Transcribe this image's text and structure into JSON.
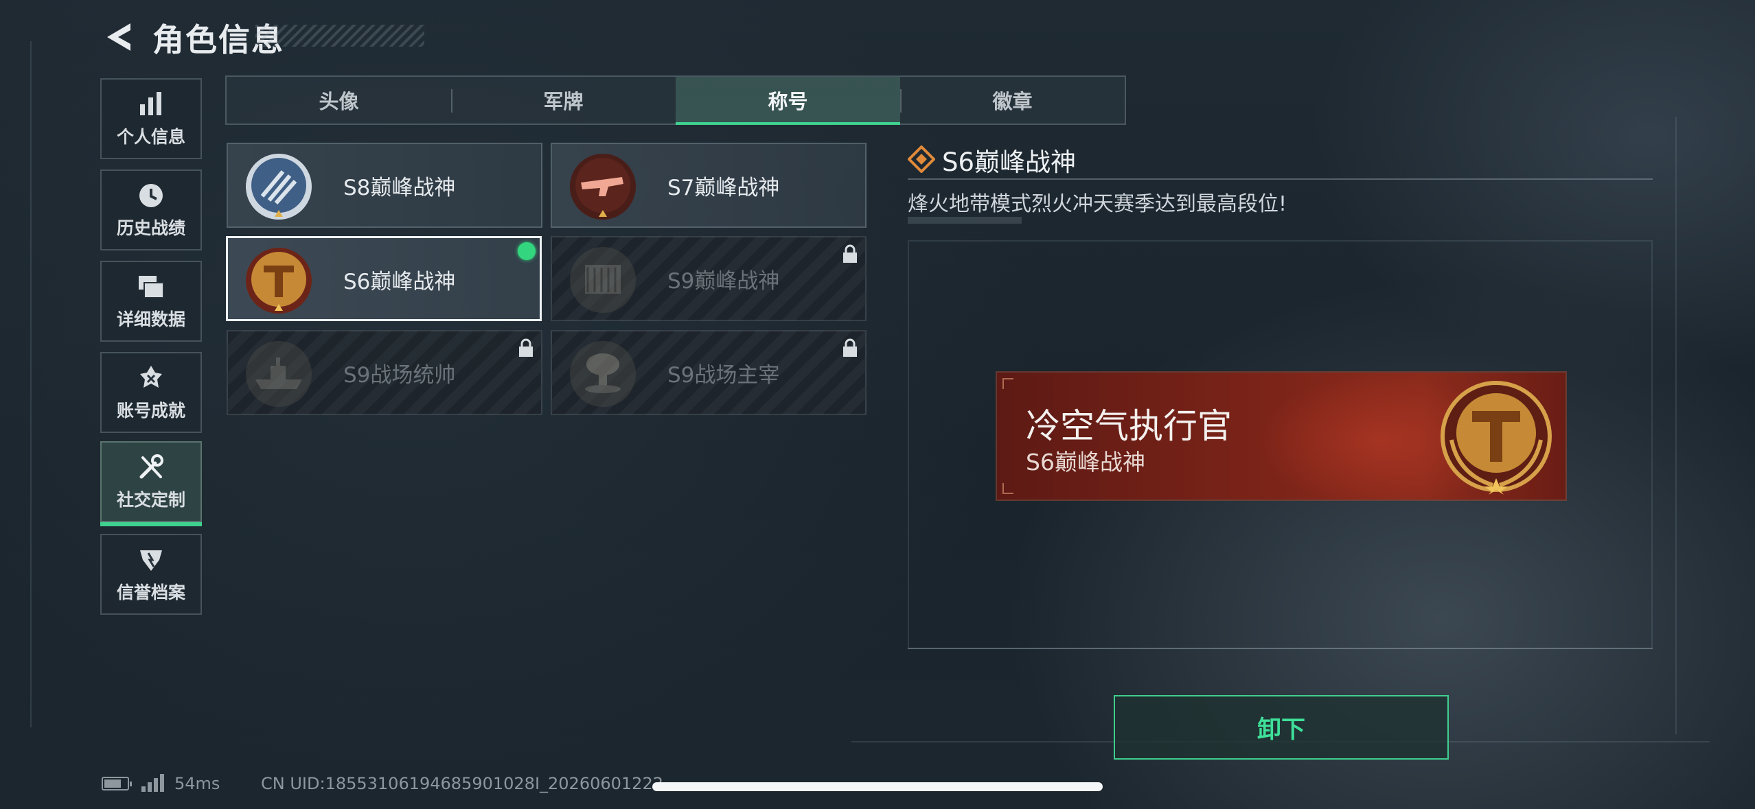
{
  "header": {
    "title": "角色信息"
  },
  "sidebar": {
    "items": [
      {
        "label": "个人信息",
        "icon": "bar-chart-icon",
        "active": false
      },
      {
        "label": "历史战绩",
        "icon": "clock-icon",
        "active": false
      },
      {
        "label": "详细数据",
        "icon": "folders-icon",
        "active": false
      },
      {
        "label": "账号成就",
        "icon": "achievement-icon",
        "active": false
      },
      {
        "label": "社交定制",
        "icon": "tools-icon",
        "active": true
      },
      {
        "label": "信誉档案",
        "icon": "shield-icon",
        "active": false
      }
    ]
  },
  "tabs": [
    {
      "label": "头像",
      "active": false
    },
    {
      "label": "军牌",
      "active": false
    },
    {
      "label": "称号",
      "active": true
    },
    {
      "label": "徽章",
      "active": false
    }
  ],
  "cards": [
    {
      "name": "S8巅峰战神",
      "emblem": "blue-shield-emblem",
      "locked": false,
      "selected": false,
      "equipped": false
    },
    {
      "name": "S7巅峰战神",
      "emblem": "red-gun-emblem",
      "locked": false,
      "selected": false,
      "equipped": false
    },
    {
      "name": "S6巅峰战神",
      "emblem": "gold-t-emblem",
      "locked": false,
      "selected": true,
      "equipped": true
    },
    {
      "name": "S9巅峰战神",
      "emblem": "dam-emblem",
      "locked": true,
      "selected": false,
      "equipped": false
    },
    {
      "name": "S9战场统帅",
      "emblem": "ship-emblem",
      "locked": true,
      "selected": false,
      "equipped": false
    },
    {
      "name": "S9战场主宰",
      "emblem": "mushroom-cloud-emblem",
      "locked": true,
      "selected": false,
      "equipped": false
    }
  ],
  "detail": {
    "title": "S6巅峰战神",
    "description": "烽火地带模式烈火冲天赛季达到最高段位!"
  },
  "nameplate": {
    "player": "冷空气执行官",
    "title": "S6巅峰战神"
  },
  "action": {
    "unequip_label": "卸下"
  },
  "status": {
    "ping": "54ms",
    "uid": "CN UID:18553106194685901028I_20260601222"
  },
  "colors": {
    "accent": "#3fd18f",
    "equipped_dot": "#33d67e",
    "nameplate_red": "#7a2318",
    "gold": "#d79a3a"
  }
}
